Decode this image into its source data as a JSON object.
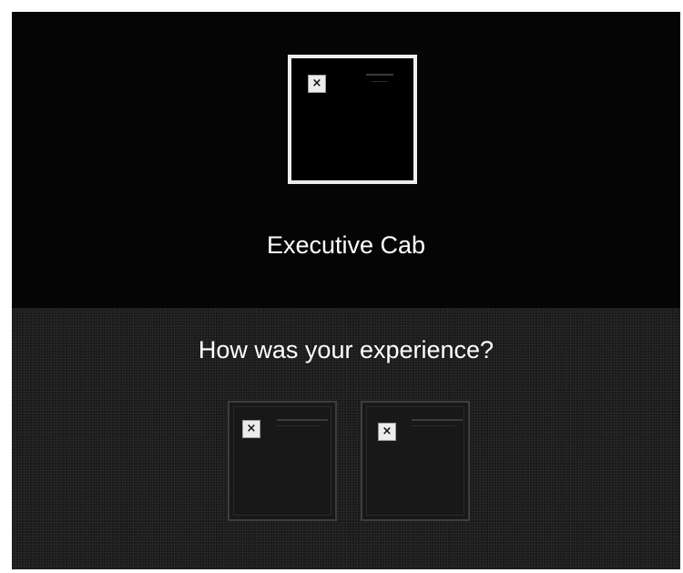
{
  "vehicle": {
    "title": "Executive Cab",
    "image_icon": "broken-image-icon",
    "image_icon_glyph": "×"
  },
  "feedback": {
    "question": "How was your experience?",
    "options": [
      {
        "icon": "broken-image-icon",
        "glyph": "×"
      },
      {
        "icon": "broken-image-icon",
        "glyph": "×"
      }
    ]
  },
  "colors": {
    "background": "#050505",
    "text": "#ffffff",
    "frame": "#ededed"
  }
}
